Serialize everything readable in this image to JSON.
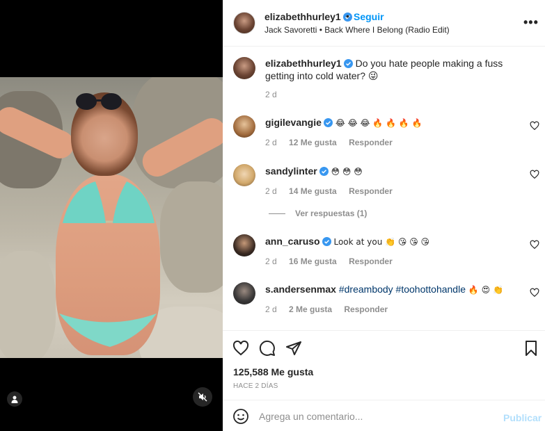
{
  "post": {
    "username": "elizabethhurley1",
    "separator": "•",
    "follow_label": "Seguir",
    "audio": "Jack Savoretti • Back Where I Belong (Radio Edit)",
    "more_label": "•••"
  },
  "caption": {
    "username": "elizabethhurley1",
    "text": "Do you hate people making a fuss getting into cold water? 😜",
    "time": "2 d"
  },
  "comments": [
    {
      "username": "gigilevangie",
      "text": "😂 😂 😂 🔥 🔥 🔥 🔥",
      "time": "2 d",
      "likes": "12 Me gusta",
      "reply_label": "Responder"
    },
    {
      "username": "sandylinter",
      "text": "😳 😳 😳",
      "time": "2 d",
      "likes": "14 Me gusta",
      "reply_label": "Responder",
      "view_replies": "Ver respuestas (1)"
    },
    {
      "username": "ann_caruso",
      "text": "Look at you 👏 😘 😘 😘",
      "time": "2 d",
      "likes": "16 Me gusta",
      "reply_label": "Responder"
    },
    {
      "username": "s.andersenmax",
      "text_tags": "#dreambody #toohottohandle",
      "text_emoji": "🔥 😍 👏",
      "time": "2 d",
      "likes": "2 Me gusta",
      "reply_label": "Responder"
    }
  ],
  "stats": {
    "likes": "125,588 Me gusta",
    "ago": "HACE 2 DÍAS"
  },
  "composer": {
    "placeholder": "Agrega un comentario...",
    "publish_label": "Publicar"
  },
  "colors": {
    "accent": "#0095f6",
    "verified": "#3897f0",
    "muted": "#8e8e8e",
    "publish_disabled": "#b2dffc"
  }
}
